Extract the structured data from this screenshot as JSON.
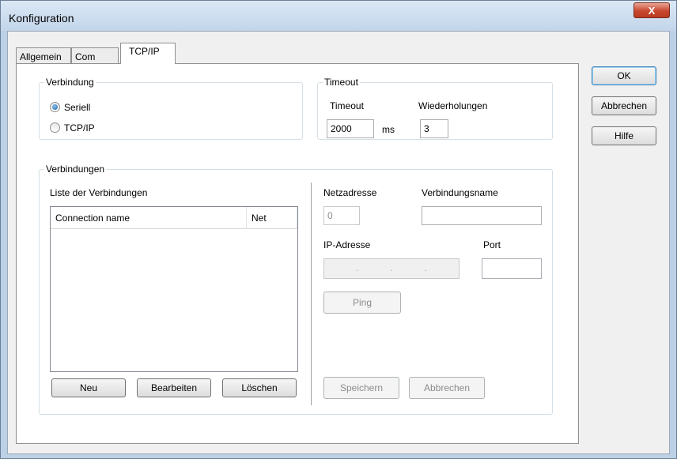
{
  "window": {
    "title": "Konfiguration",
    "close_label": "X"
  },
  "tabs": [
    {
      "label": "Allgemein"
    },
    {
      "label": "Com"
    },
    {
      "label": "TCP/IP"
    }
  ],
  "verbindung": {
    "legend": "Verbindung",
    "options": [
      {
        "label": "Seriell",
        "selected": true
      },
      {
        "label": "TCP/IP",
        "selected": false
      }
    ]
  },
  "timeout": {
    "legend": "Timeout",
    "timeout_label": "Timeout",
    "timeout_value": "2000",
    "unit": "ms",
    "retries_label": "Wiederholungen",
    "retries_value": "3"
  },
  "verbindungen": {
    "legend": "Verbindungen",
    "list_label": "Liste der Verbindungen",
    "columns": [
      "Connection name",
      "Net"
    ],
    "rows": [],
    "buttons": {
      "new": "Neu",
      "edit": "Bearbeiten",
      "delete": "Löschen"
    },
    "net_address_label": "Netzadresse",
    "net_address_value": "0",
    "connection_name_label": "Verbindungsname",
    "connection_name_value": "",
    "ip_label": "IP-Adresse",
    "ip_dots": [
      ".",
      ".",
      "."
    ],
    "port_label": "Port",
    "port_value": "",
    "ping": "Ping",
    "save": "Speichern",
    "cancel": "Abbrechen"
  },
  "dialog_buttons": {
    "ok": "OK",
    "cancel": "Abbrechen",
    "help": "Hilfe"
  }
}
